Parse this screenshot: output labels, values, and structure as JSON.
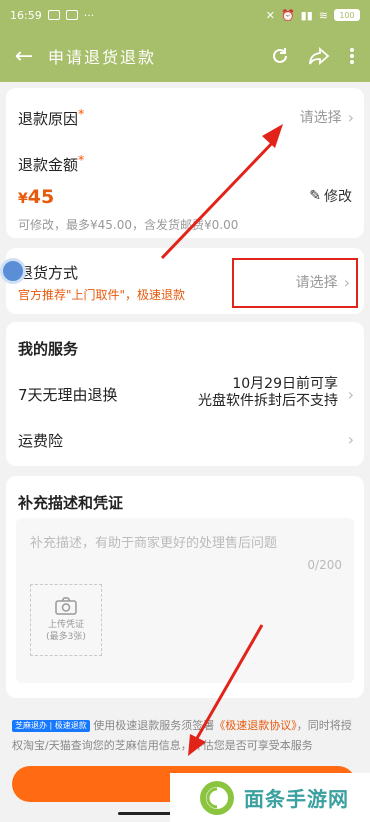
{
  "status_bar": {
    "time": "16:59",
    "battery": "100"
  },
  "header": {
    "title": "申请退货退款"
  },
  "refund_reason": {
    "label": "退款原因",
    "required_mark": "*",
    "value": "请选择"
  },
  "refund_amount": {
    "label": "退款金额",
    "required_mark": "*",
    "currency": "¥",
    "amount": "45",
    "hint": "可修改，最多¥45.00，含发货邮费¥0.00",
    "edit_label": "修改"
  },
  "return_method": {
    "label": "退货方式",
    "promo": "官方推荐\"上门取件\"，极速退款",
    "value": "请选择"
  },
  "services": {
    "title": "我的服务",
    "items": [
      {
        "label": "7天无理由退换",
        "line1": "10月29日前可享",
        "line2": "光盘软件拆封后不支持"
      },
      {
        "label": "运费险"
      }
    ]
  },
  "evidence": {
    "title": "补充描述和凭证",
    "placeholder": "补充描述，有助于商家更好的处理售后问题",
    "counter": "0/200",
    "upload_label": "上传凭证",
    "upload_limit": "(最多3张)"
  },
  "agreement": {
    "badge_left": "芝麻退办",
    "badge_right": "极速退款",
    "text_a": "使用极速退款服务须签署",
    "link": "《极速退款协议》",
    "text_b": "，同时将授权淘宝/天猫查询您的芝麻信用信息，评估您是否可享受本服务"
  },
  "watermark": {
    "text": "面条手游网"
  },
  "colors": {
    "header_bg": "#a7be6a",
    "accent": "#ff6a12",
    "annotation_red": "#e2231a"
  }
}
